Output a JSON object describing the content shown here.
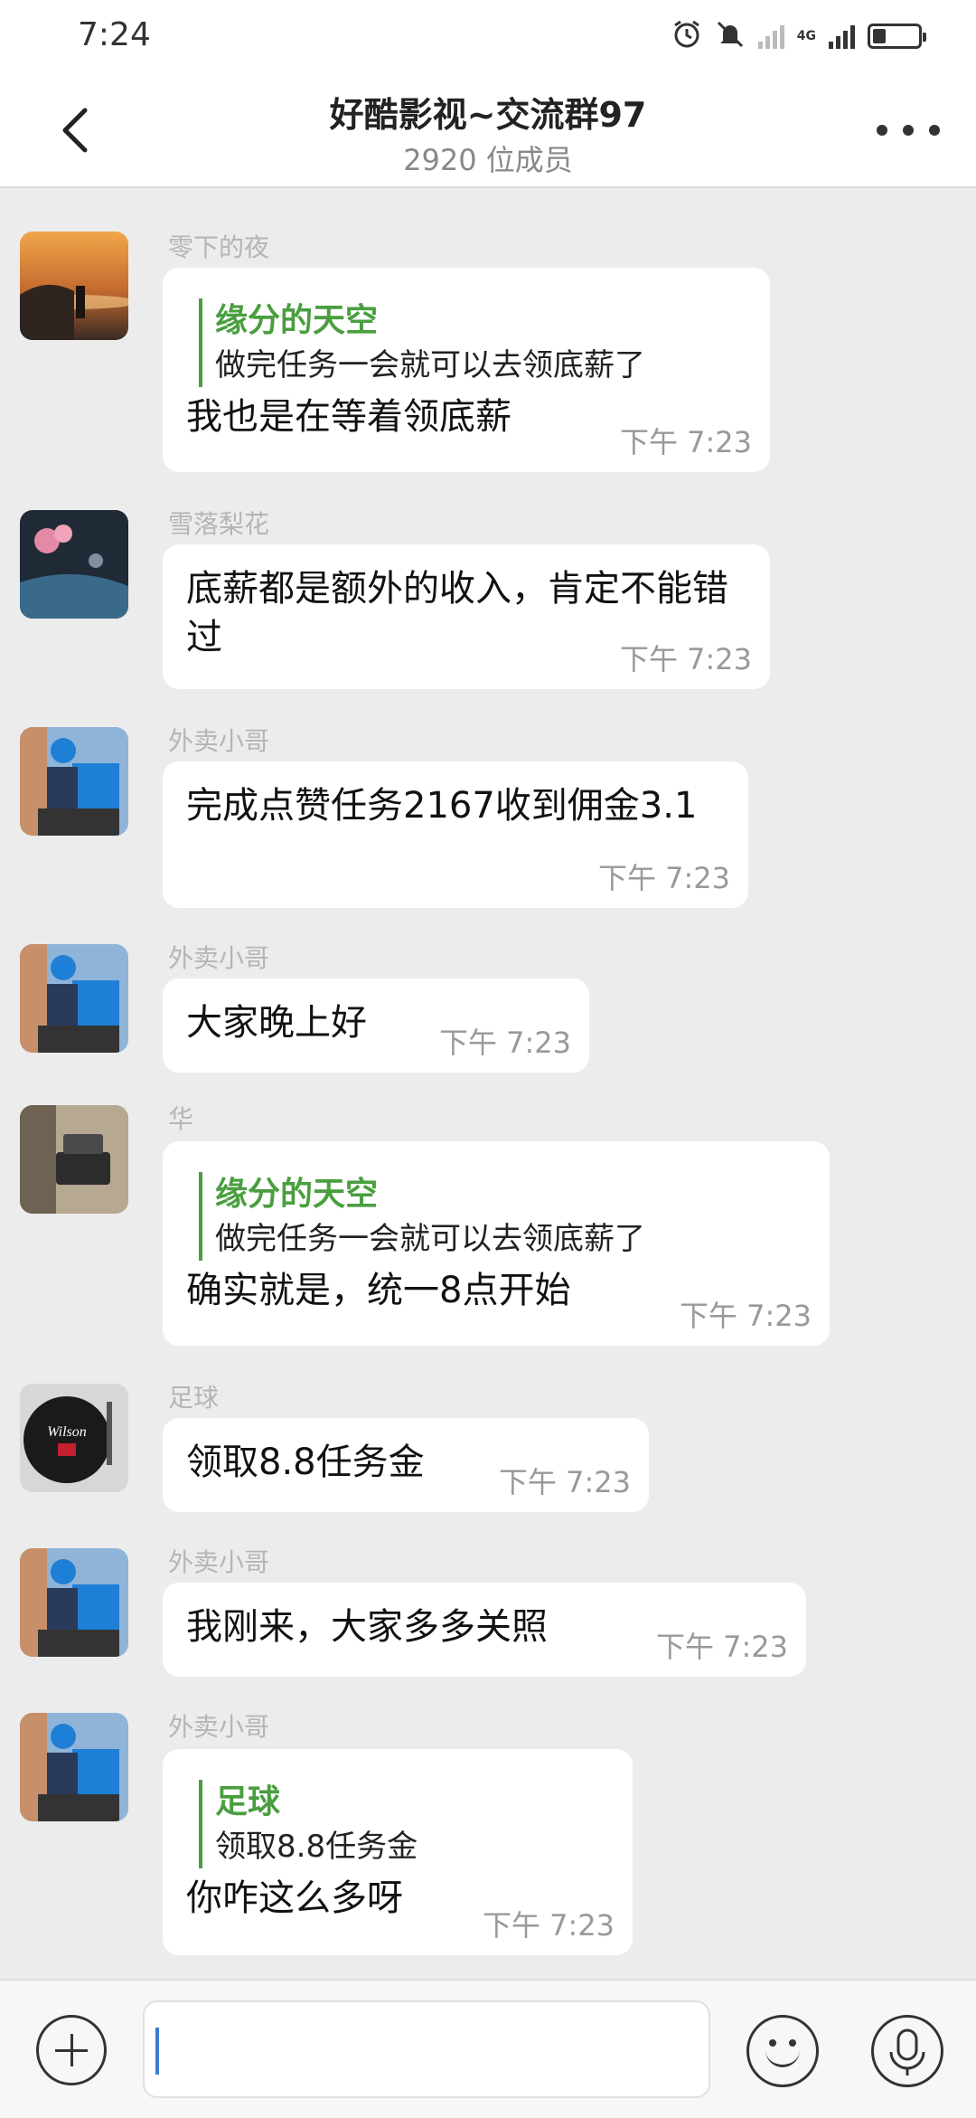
{
  "status_bar": {
    "time": "7:24",
    "network": "4G",
    "icons": [
      "alarm-icon",
      "mute-icon",
      "signal-icon",
      "battery-icon"
    ],
    "battery_level": 0.3
  },
  "header": {
    "title": "好酷影视~交流群97",
    "member_count": "2920 位成员"
  },
  "messages": [
    {
      "sender": "零下的夜",
      "quote": {
        "name": "缘分的天空",
        "text": "做完任务一会就可以去领底薪了"
      },
      "text": "我也是在等着领底薪",
      "time": "下午 7:23"
    },
    {
      "sender": "雪落梨花",
      "text": "底薪都是额外的收入，肯定不能错过",
      "time": "下午 7:23"
    },
    {
      "sender": "外卖小哥",
      "text": "完成点赞任务2167收到佣金3.1",
      "time": "下午 7:23"
    },
    {
      "sender": "外卖小哥",
      "text": "大家晚上好",
      "time": "下午 7:23"
    },
    {
      "sender": "华",
      "quote": {
        "name": "缘分的天空",
        "text": "做完任务一会就可以去领底薪了"
      },
      "text": "确实就是，统一8点开始",
      "time": "下午 7:23"
    },
    {
      "sender": "足球",
      "text": "领取8.8任务金",
      "time": "下午 7:23"
    },
    {
      "sender": "外卖小哥",
      "text": "我刚来，大家多多关照",
      "time": "下午 7:23"
    },
    {
      "sender": "外卖小哥",
      "quote": {
        "name": "足球",
        "text": "领取8.8任务金"
      },
      "text": "你咋这么多呀",
      "time": "下午 7:23"
    }
  ],
  "colors": {
    "accent_green": "#4a9e3f",
    "chat_bg": "#ececec",
    "bubble_bg": "#ffffff"
  }
}
